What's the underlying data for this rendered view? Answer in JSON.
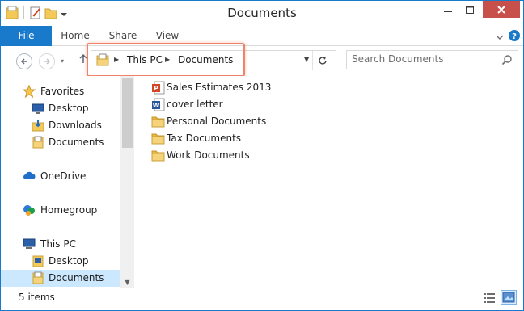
{
  "window": {
    "title": "Documents"
  },
  "ribbon": {
    "tabs": [
      "File",
      "Home",
      "Share",
      "View"
    ]
  },
  "address_bar": {
    "crumbs": [
      "This PC",
      "Documents"
    ]
  },
  "search": {
    "placeholder": "Search Documents"
  },
  "nav_pane": {
    "favorites_label": "Favorites",
    "favorites_items": [
      "Desktop",
      "Downloads",
      "Documents"
    ],
    "onedrive_label": "OneDrive",
    "homegroup_label": "Homegroup",
    "thispc_label": "This PC",
    "thispc_items": [
      "Desktop",
      "Documents"
    ],
    "selected": "Documents"
  },
  "files": [
    {
      "name": "Sales Estimates 2013",
      "icon": "powerpoint-icon"
    },
    {
      "name": "cover letter",
      "icon": "word-icon"
    },
    {
      "name": "Personal Documents",
      "icon": "folder-icon"
    },
    {
      "name": "Tax Documents",
      "icon": "folder-icon"
    },
    {
      "name": "Work Documents",
      "icon": "folder-icon"
    }
  ],
  "status": {
    "count": "5 items"
  },
  "colors": {
    "accent": "#1979ca",
    "close": "#c7504b",
    "highlight": "#f0826a",
    "selected_bg": "#cce8ff"
  }
}
